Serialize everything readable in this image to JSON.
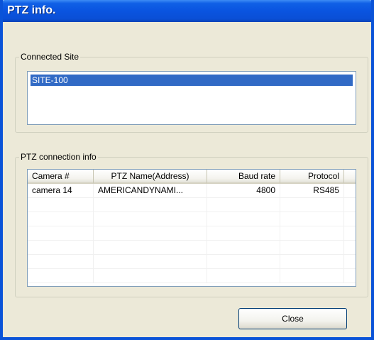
{
  "window": {
    "title": "PTZ info."
  },
  "connected_site": {
    "legend": "Connected Site",
    "items": [
      "SITE-100"
    ],
    "selected": "SITE-100"
  },
  "ptz_info": {
    "legend": "PTZ connection info",
    "columns": [
      "Camera #",
      "PTZ Name(Address)",
      "Baud rate",
      "Protocol"
    ],
    "rows": [
      {
        "camera": "camera 14",
        "name": "AMERICANDYNAMI...",
        "baud": "4800",
        "protocol": "RS485"
      }
    ]
  },
  "buttons": {
    "close_label": "Close"
  },
  "colors": {
    "titlebar": "#0a54e0",
    "selection": "#316ac5",
    "window_bg": "#ece9d8"
  }
}
